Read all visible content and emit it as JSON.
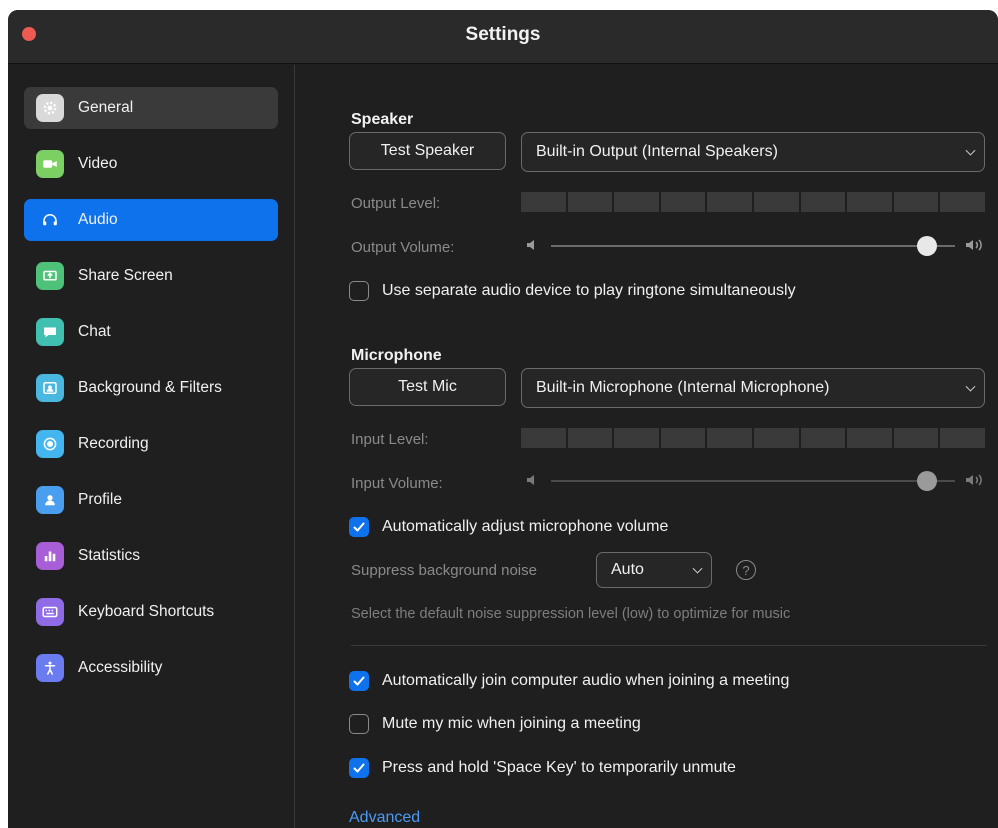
{
  "window": {
    "title": "Settings"
  },
  "sidebar": {
    "items": [
      {
        "label": "General",
        "icon": "gear-icon",
        "color": "#d9d9d9"
      },
      {
        "label": "Video",
        "icon": "camera-icon",
        "color": "#7ccf62"
      },
      {
        "label": "Audio",
        "icon": "headphones-icon",
        "color": "#0e72ed"
      },
      {
        "label": "Share Screen",
        "icon": "share-screen-icon",
        "color": "#4fc27a"
      },
      {
        "label": "Chat",
        "icon": "chat-icon",
        "color": "#3fc0b0"
      },
      {
        "label": "Background & Filters",
        "icon": "background-icon",
        "color": "#49b7e0"
      },
      {
        "label": "Recording",
        "icon": "record-icon",
        "color": "#43b6f0"
      },
      {
        "label": "Profile",
        "icon": "person-icon",
        "color": "#4a9ef0"
      },
      {
        "label": "Statistics",
        "icon": "bar-chart-icon",
        "color": "#a75ed6"
      },
      {
        "label": "Keyboard Shortcuts",
        "icon": "keyboard-icon",
        "color": "#8f6ce6"
      },
      {
        "label": "Accessibility",
        "icon": "accessibility-icon",
        "color": "#6b7cf0"
      }
    ]
  },
  "speaker": {
    "section_title": "Speaker",
    "test_button": "Test Speaker",
    "device": "Built-in Output (Internal Speakers)",
    "output_level_label": "Output Level:",
    "output_volume_label": "Output Volume:",
    "output_volume": 0.93,
    "ringtone_checkbox": {
      "label": "Use separate audio device to play ringtone simultaneously",
      "checked": false
    }
  },
  "microphone": {
    "section_title": "Microphone",
    "test_button": "Test Mic",
    "device": "Built-in Microphone (Internal Microphone)",
    "input_level_label": "Input Level:",
    "input_volume_label": "Input Volume:",
    "input_volume": 0.93,
    "auto_adjust": {
      "label": "Automatically adjust microphone volume",
      "checked": true
    },
    "suppress_label": "Suppress background noise",
    "suppress_value": "Auto",
    "help": "?",
    "hint": "Select the default noise suppression level (low) to optimize for music"
  },
  "options": {
    "auto_join": {
      "label": "Automatically join computer audio when joining a meeting",
      "checked": true
    },
    "mute_on_join": {
      "label": "Mute my mic when joining a meeting",
      "checked": false
    },
    "space_unmute": {
      "label": "Press and hold 'Space Key' to temporarily unmute",
      "checked": true
    }
  },
  "advanced_link": "Advanced",
  "colors": {
    "accent": "#0e72ed",
    "link": "#4b9bf5",
    "close": "#ee5a52"
  }
}
